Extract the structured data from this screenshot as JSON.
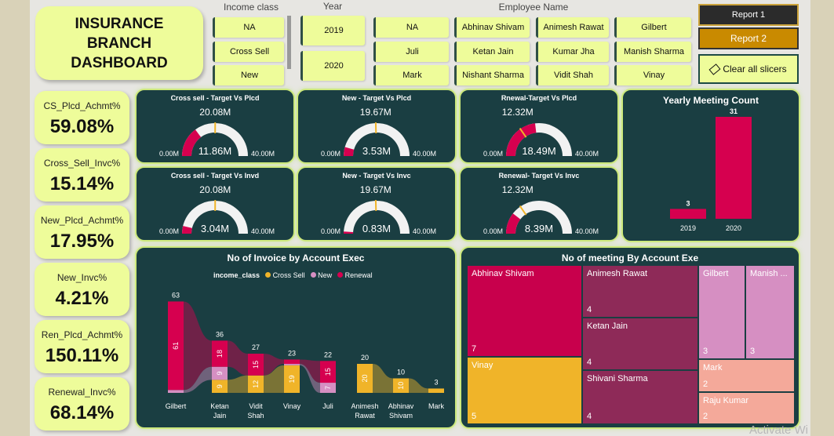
{
  "title": "INSURANCE BRANCH DASHBOARD",
  "slicers": {
    "income_class": {
      "header": "Income class",
      "items": [
        "NA",
        "Cross Sell",
        "New"
      ]
    },
    "year": {
      "header": "Year",
      "items": [
        "2019",
        "2020"
      ]
    },
    "employee": {
      "header": "Employee Name",
      "items": [
        "NA",
        "Abhinav Shivam",
        "Animesh Rawat",
        "Gilbert",
        "Juli",
        "Ketan Jain",
        "Kumar Jha",
        "Manish Sharma",
        "Mark",
        "Nishant Sharma",
        "Vidit Shah",
        "Vinay"
      ]
    }
  },
  "buttons": {
    "report1": "Report 1",
    "report2": "Report 2",
    "clear": "Clear all slicers"
  },
  "kpis": [
    {
      "label": "CS_Plcd_Achmt%",
      "value": "59.08%"
    },
    {
      "label": "Cross_Sell_Invc%",
      "value": "15.14%"
    },
    {
      "label": "New_Plcd_Achmt%",
      "value": "17.95%"
    },
    {
      "label": "New_Invc%",
      "value": "4.21%"
    },
    {
      "label": "Ren_Plcd_Achmt%",
      "value": "150.11%"
    },
    {
      "label": "Renewal_Invc%",
      "value": "68.14%"
    }
  ],
  "gauges": [
    {
      "title": "Cross sell - Target Vs Plcd",
      "value": "11.86M",
      "target": "20.08M",
      "min": "0.00M",
      "max": "40.00M",
      "fraction": 0.2965,
      "target_fraction": 0.502
    },
    {
      "title": "New - Target Vs Plcd",
      "value": "3.53M",
      "target": "19.67M",
      "min": "0.00M",
      "max": "40.00M",
      "fraction": 0.088,
      "target_fraction": 0.492
    },
    {
      "title": "Rnewal-Target Vs Plcd",
      "value": "18.49M",
      "target": "12.32M",
      "min": "0.00M",
      "max": "40.00M",
      "fraction": 0.462,
      "target_fraction": 0.308
    },
    {
      "title": "Cross sell - Target Vs Invd",
      "value": "3.04M",
      "target": "20.08M",
      "min": "0.00M",
      "max": "40.00M",
      "fraction": 0.076,
      "target_fraction": 0.502
    },
    {
      "title": "New - Target Vs Invc",
      "value": "0.83M",
      "target": "19.67M",
      "min": "0.00M",
      "max": "40.00M",
      "fraction": 0.021,
      "target_fraction": 0.492
    },
    {
      "title": "Renewal- Target Vs Invc",
      "value": "8.39M",
      "target": "12.32M",
      "min": "0.00M",
      "max": "40.00M",
      "fraction": 0.21,
      "target_fraction": 0.308
    }
  ],
  "colors": {
    "renewal": "#d6004f",
    "new": "#d68fc2",
    "cross_sell": "#f0b429",
    "gauge_track": "#f2f2f2",
    "card_bg": "#1a3e42"
  },
  "yearly": {
    "title": "Yearly Meeting Count",
    "chart_data": {
      "type": "bar",
      "categories": [
        "2019",
        "2020"
      ],
      "values": [
        3,
        31
      ]
    }
  },
  "invoice": {
    "title": "No of Invoice by Account Exec",
    "legend_title": "income_class",
    "legend": [
      "Cross Sell",
      "New",
      "Renewal"
    ],
    "chart_data": {
      "type": "bar",
      "categories": [
        "Gilbert",
        "Ketan Jain",
        "Vidit Shah",
        "Vinay",
        "Juli",
        "Animesh Rawat",
        "Abhinav Shivam",
        "Mark"
      ],
      "totals": [
        63,
        36,
        27,
        23,
        22,
        20,
        10,
        3
      ],
      "series": [
        {
          "name": "Cross Sell",
          "values": [
            0,
            9,
            12,
            19,
            0,
            20,
            10,
            3
          ]
        },
        {
          "name": "New",
          "values": [
            2,
            9,
            0,
            1,
            7,
            0,
            0,
            0
          ]
        },
        {
          "name": "Renewal",
          "values": [
            61,
            18,
            15,
            3,
            15,
            0,
            0,
            0
          ]
        }
      ]
    }
  },
  "meetings": {
    "title": "No of meeting By Account Exe",
    "items": [
      {
        "name": "Abhinav Shivam",
        "value": "7"
      },
      {
        "name": "Animesh Rawat",
        "value": "4"
      },
      {
        "name": "Gilbert",
        "value": "3"
      },
      {
        "name": "Manish ...",
        "value": "3"
      },
      {
        "name": "Ketan Jain",
        "value": "4"
      },
      {
        "name": "Mark",
        "value": "2"
      },
      {
        "name": "Vinay",
        "value": "5"
      },
      {
        "name": "Shivani Sharma",
        "value": "4"
      },
      {
        "name": "Raju Kumar",
        "value": "2"
      }
    ]
  },
  "watermark": "Activate Wi"
}
